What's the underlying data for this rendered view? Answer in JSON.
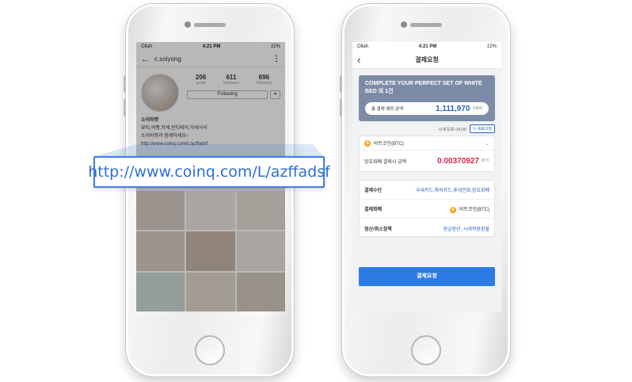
{
  "left_phone": {
    "status": {
      "carrier": "Ollah",
      "time": "4:21 PM",
      "battery": "22%"
    },
    "header": {
      "username": "c.soiyong"
    },
    "stats": [
      {
        "value": "206",
        "label": "posts"
      },
      {
        "value": "611",
        "label": "followers"
      },
      {
        "value": "696",
        "label": "following"
      }
    ],
    "follow_label": "Following",
    "bio": {
      "name": "소이마켓",
      "line1": "뷰티,여행,악세,빈티테이,악세사리",
      "line2": "소이마켓과 함께하세요~",
      "link": "http://www.coinq.com/L/azffadsf"
    }
  },
  "callout": {
    "url": "http://www.coinq.com/L/azffadsf"
  },
  "right_phone": {
    "status": {
      "carrier": "Ollah",
      "time": "4:21 PM",
      "battery": "22%"
    },
    "header": {
      "title": "결제요청"
    },
    "product": {
      "title": "COMPLETE YOUR PERPECT SET OF WHITE BED 외 1건",
      "total_label": "총 결제 예정 금액",
      "total_amount": "1,111,970",
      "total_currency": "KRW"
    },
    "timer": {
      "label": "시세유효 04:00",
      "refresh_label": "새로고침"
    },
    "coin": {
      "selected": "비트코인(BTC)",
      "amount_label": "암호화폐 결제시 금액",
      "amount": "0.00370927",
      "amount_currency": "BTC"
    },
    "info": [
      {
        "label": "결제수단",
        "value": "국내카드,해외카드,휴대전화,암호화폐"
      },
      {
        "label": "결제화폐",
        "value": "비트코인(BTC)"
      },
      {
        "label": "정산/취소정책",
        "value": "현금정산, 시세적용환불"
      }
    ],
    "pay_button": "결제요청"
  },
  "colors": {
    "accent": "#2c7be5",
    "product_card": "#7d8ca6",
    "crypto_amount": "#e0204f",
    "btc": "#f2a31b"
  }
}
